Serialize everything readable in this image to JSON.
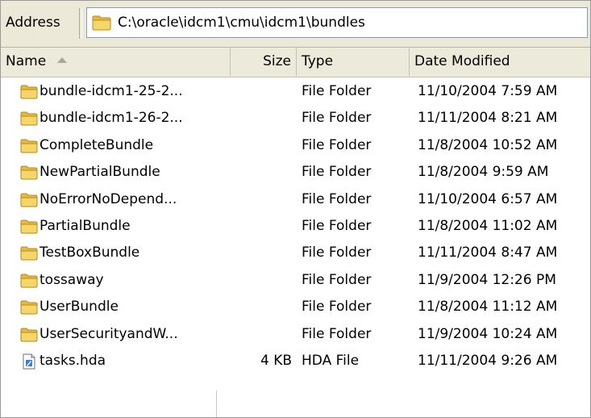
{
  "address": {
    "label": "Address",
    "path": "C:\\oracle\\idcm1\\cmu\\idcm1\\bundles"
  },
  "columns": {
    "name": "Name",
    "size": "Size",
    "type": "Type",
    "date": "Date Modified"
  },
  "rows": [
    {
      "name": "bundle-idcm1-25-2...",
      "size": "",
      "type": "File Folder",
      "date": "11/10/2004 7:59 AM",
      "icon": "folder-icon"
    },
    {
      "name": "bundle-idcm1-26-2...",
      "size": "",
      "type": "File Folder",
      "date": "11/11/2004 8:21 AM",
      "icon": "folder-icon"
    },
    {
      "name": "CompleteBundle",
      "size": "",
      "type": "File Folder",
      "date": "11/8/2004 10:52 AM",
      "icon": "folder-icon"
    },
    {
      "name": "NewPartialBundle",
      "size": "",
      "type": "File Folder",
      "date": "11/8/2004 9:59 AM",
      "icon": "folder-icon"
    },
    {
      "name": "NoErrorNoDepend...",
      "size": "",
      "type": "File Folder",
      "date": "11/10/2004 6:57 AM",
      "icon": "folder-icon"
    },
    {
      "name": "PartialBundle",
      "size": "",
      "type": "File Folder",
      "date": "11/8/2004 11:02 AM",
      "icon": "folder-icon"
    },
    {
      "name": "TestBoxBundle",
      "size": "",
      "type": "File Folder",
      "date": "11/11/2004 8:47 AM",
      "icon": "folder-icon"
    },
    {
      "name": "tossaway",
      "size": "",
      "type": "File Folder",
      "date": "11/9/2004 12:26 PM",
      "icon": "folder-icon"
    },
    {
      "name": "UserBundle",
      "size": "",
      "type": "File Folder",
      "date": "11/8/2004 11:12 AM",
      "icon": "folder-icon"
    },
    {
      "name": "UserSecurityandW...",
      "size": "",
      "type": "File Folder",
      "date": "11/9/2004 10:24 AM",
      "icon": "folder-icon"
    },
    {
      "name": "tasks.hda",
      "size": "4 KB",
      "type": "HDA File",
      "date": "11/11/2004 9:26 AM",
      "icon": "document-icon"
    }
  ],
  "colors": {
    "folder": "#f2cf57",
    "chrome": "#ece9d8",
    "header": "#ebeadb"
  }
}
